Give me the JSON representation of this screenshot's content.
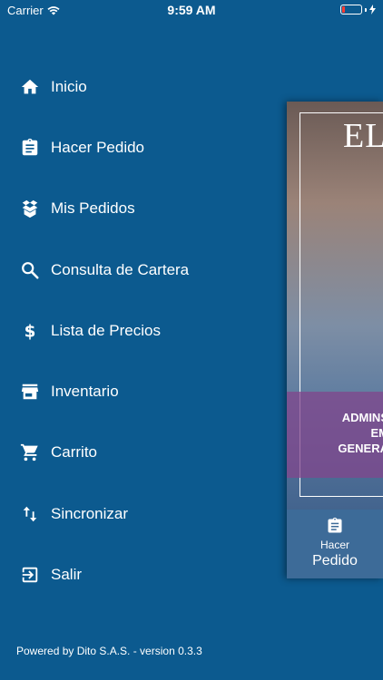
{
  "status_bar": {
    "carrier": "Carrier",
    "time": "9:59 AM",
    "battery_level": 0.15,
    "battery_color": "#ff3b30"
  },
  "menu": {
    "items": [
      {
        "label": "Inicio",
        "icon": "home-icon"
      },
      {
        "label": "Hacer Pedido",
        "icon": "clipboard-icon"
      },
      {
        "label": "Mis Pedidos",
        "icon": "open-box-icon"
      },
      {
        "label": "Consulta de Cartera",
        "icon": "search-icon"
      },
      {
        "label": "Lista de Precios",
        "icon": "dollar-icon"
      },
      {
        "label": "Inventario",
        "icon": "store-icon"
      },
      {
        "label": "Carrito",
        "icon": "cart-icon"
      },
      {
        "label": "Sincronizar",
        "icon": "sync-arrows-icon"
      },
      {
        "label": "Salir",
        "icon": "exit-icon"
      }
    ]
  },
  "footer": {
    "text": "Powered by Dito S.A.S. - version 0.3.3"
  },
  "preview": {
    "logo": "EL",
    "banner": "ADMINS\nEM\nGENERA",
    "tab": {
      "line1": "Hacer",
      "line2": "Pedido",
      "icon": "clipboard-icon"
    }
  },
  "colors": {
    "background": "#0c5a8f",
    "text": "#ffffff",
    "tab_background": "#3d6b98"
  }
}
